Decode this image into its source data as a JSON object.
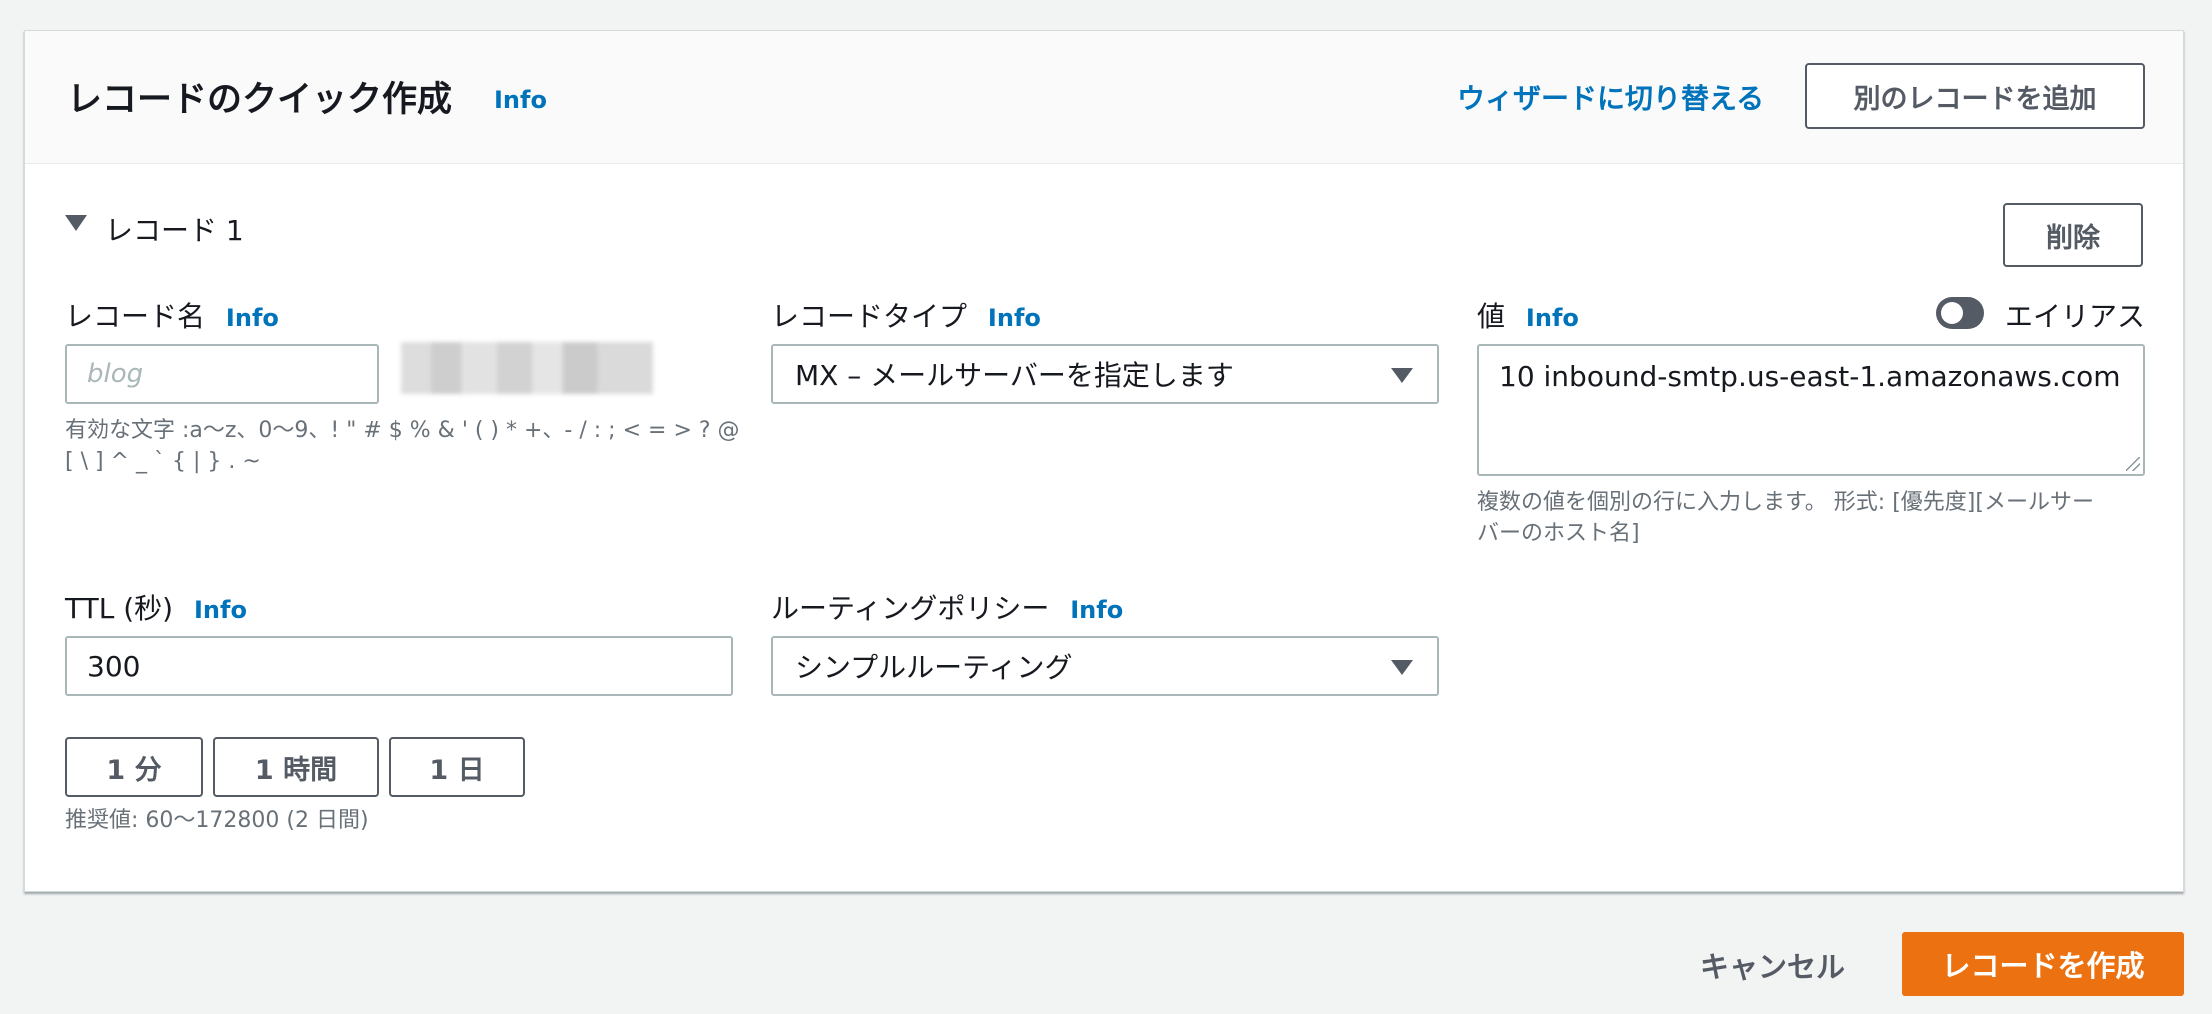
{
  "header": {
    "title": "レコードのクイック作成",
    "info": "Info",
    "wizard_link": "ウィザードに切り替える",
    "add_record_button": "別のレコードを追加"
  },
  "record": {
    "section_label": "レコード 1",
    "delete_button": "削除",
    "name": {
      "label": "レコード名",
      "info": "Info",
      "placeholder": "blog",
      "hint_line1": "有効な文字 :a〜z、0〜9、! \" # $ % & ' ( ) * +、- / : ; < = > ? @",
      "hint_line2": "[ \\ ] ^ _ ` { | } . ~"
    },
    "type": {
      "label": "レコードタイプ",
      "info": "Info",
      "selected": "MX – メールサーバーを指定します"
    },
    "value": {
      "label": "値",
      "info": "Info",
      "alias_label": "エイリアス",
      "alias_enabled": false,
      "text": "10 inbound-smtp.us-east-1.amazonaws.com",
      "hint_line1": "複数の値を個別の行に入力します。 形式: [優先度][メールサー",
      "hint_line2": "バーのホスト名]"
    },
    "ttl": {
      "label": "TTL (秒)",
      "info": "Info",
      "value": "300",
      "presets": [
        "1 分",
        "1 時間",
        "1 日"
      ],
      "hint": "推奨値: 60〜172800 (2 日間)"
    },
    "routing": {
      "label": "ルーティングポリシー",
      "info": "Info",
      "selected": "シンプルルーティング"
    }
  },
  "footer": {
    "cancel": "キャンセル",
    "create": "レコードを作成"
  },
  "colors": {
    "link": "#0073bb",
    "primary_button": "#ec7211",
    "background": "#f2f3f3"
  }
}
